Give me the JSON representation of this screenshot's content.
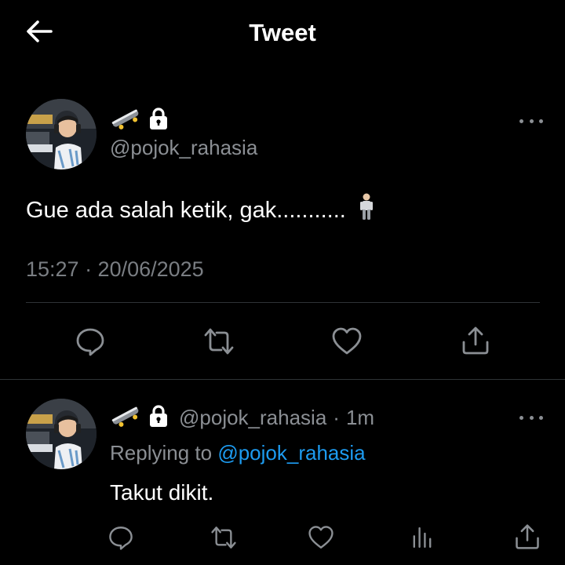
{
  "header": {
    "title": "Tweet",
    "back_icon": "arrow-left-icon"
  },
  "main_tweet": {
    "handle": "@pojok_rahasia",
    "text": "Gue ada salah ketik, gak...........",
    "timestamp": "15:27 · 20/06/2025",
    "name_icons": [
      "skateboard-icon",
      "lock-icon"
    ],
    "text_emoji": "standing-person-icon"
  },
  "main_actions": [
    "reply-icon",
    "retweet-icon",
    "like-icon",
    "share-icon"
  ],
  "reply_tweet": {
    "handle": "@pojok_rahasia",
    "separator": "·",
    "time": "1m",
    "replying_prefix": "Replying to",
    "replying_handle": "@pojok_rahasia",
    "text": "Takut dikit."
  },
  "reply_actions": [
    "reply-icon",
    "retweet-icon",
    "like-icon",
    "views-icon",
    "share-icon"
  ],
  "colors": {
    "background": "#000000",
    "text": "#ffffff",
    "muted": "#8b8f94",
    "link": "#1d9bf0",
    "divider": "#2f3336"
  }
}
